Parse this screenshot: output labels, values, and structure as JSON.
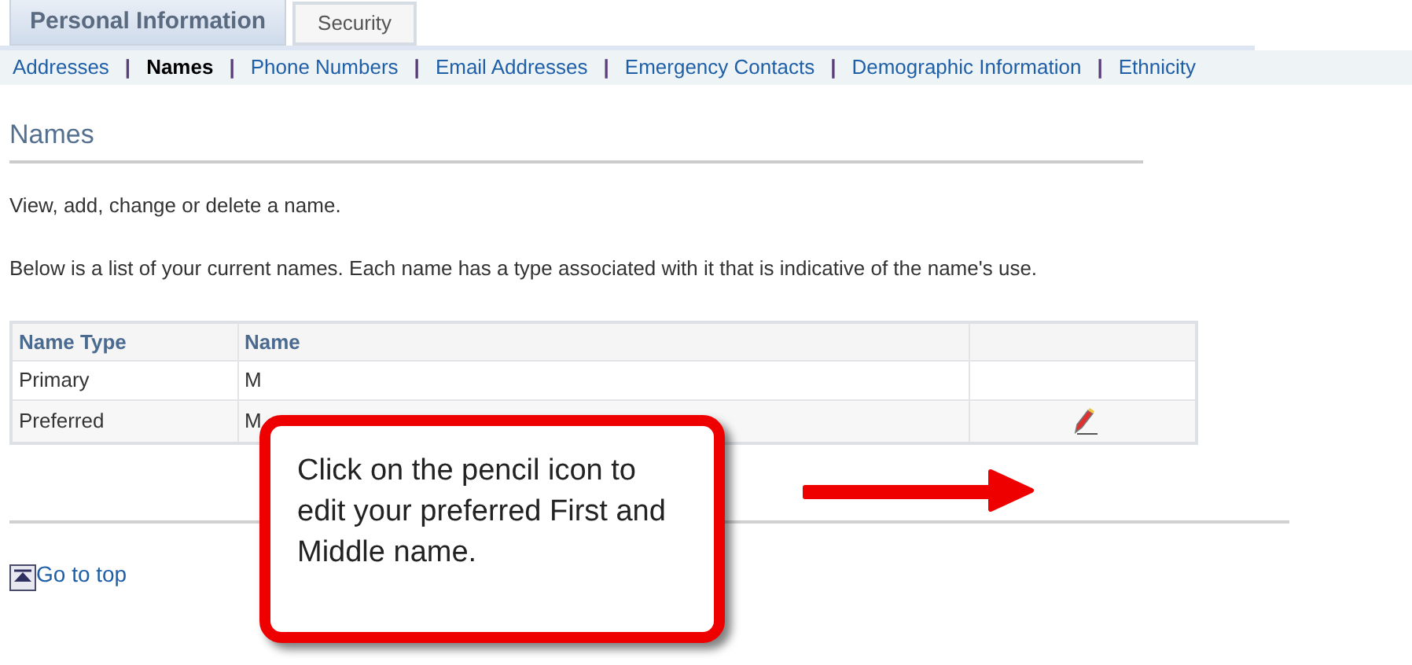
{
  "tabs": [
    {
      "label": "Personal Information",
      "selected": true
    },
    {
      "label": "Security",
      "selected": false
    }
  ],
  "subnav": [
    {
      "label": "Addresses",
      "selected": false
    },
    {
      "label": "Names",
      "selected": true
    },
    {
      "label": "Phone Numbers",
      "selected": false
    },
    {
      "label": "Email Addresses",
      "selected": false
    },
    {
      "label": "Emergency Contacts",
      "selected": false
    },
    {
      "label": "Demographic Information",
      "selected": false
    },
    {
      "label": "Ethnicity",
      "selected": false
    }
  ],
  "separator": "|",
  "heading": "Names",
  "intro": "View, add, change or delete a name.",
  "description": "Below is a list of your current names. Each name has a type associated with it that is indicative of the name's use.",
  "table": {
    "columns": [
      "Name Type",
      "Name"
    ],
    "rows": [
      {
        "name_type": "Primary",
        "name": "M",
        "editable": false
      },
      {
        "name_type": "Preferred",
        "name": "M",
        "editable": true
      }
    ]
  },
  "callout": "Click on the pencil icon to edit your preferred First and Middle name.",
  "go_to_top": "Go to top"
}
